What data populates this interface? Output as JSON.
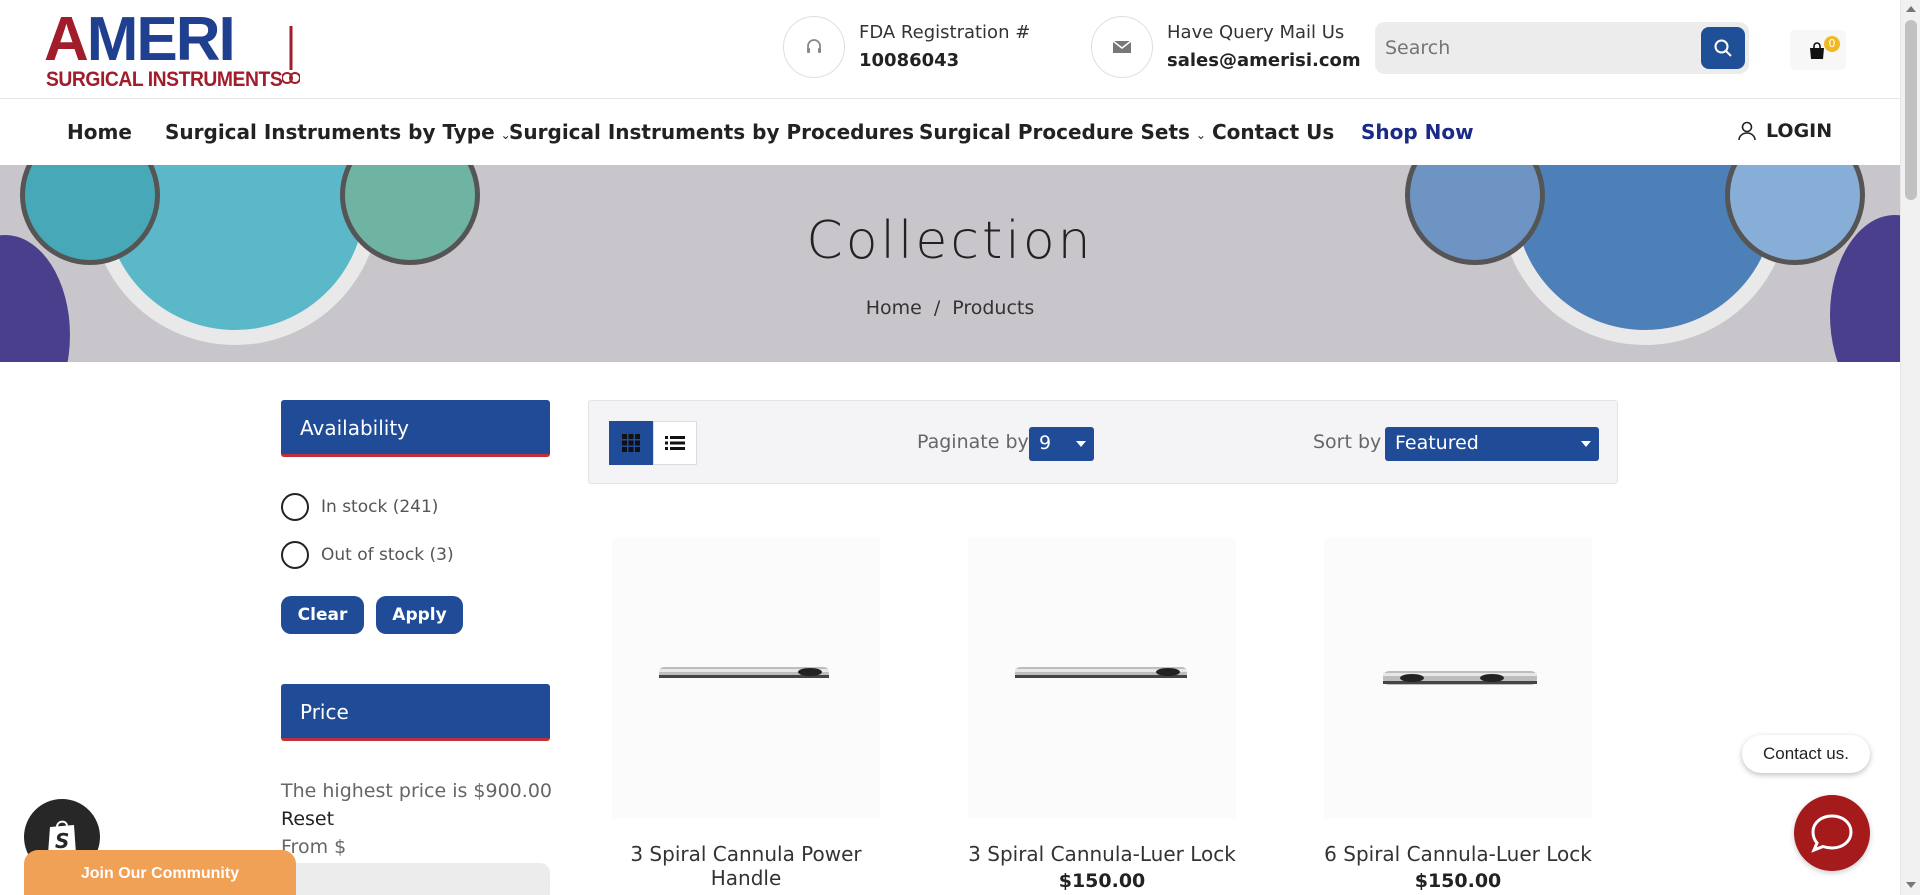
{
  "header": {
    "logo_text_part1": "A",
    "logo_text_part2": "MERI",
    "logo_subtitle": "SURGICAL INSTRUMENTS",
    "fda_label": "FDA Registration #",
    "fda_number": "10086043",
    "mail_label": "Have Query Mail Us",
    "mail_address": "sales@amerisi.com",
    "search_placeholder": "Search",
    "cart_count": "0"
  },
  "nav": {
    "items": [
      {
        "label": "Home"
      },
      {
        "label": "Surgical Instruments by Type"
      },
      {
        "label": "Surgical Instruments by Procedures"
      },
      {
        "label": "Surgical Procedure Sets"
      },
      {
        "label": "Contact Us"
      },
      {
        "label": "Shop Now"
      }
    ],
    "login_label": "LOGIN"
  },
  "hero": {
    "title": "Collection",
    "breadcrumb": [
      "Home",
      "Products"
    ]
  },
  "filters": {
    "availability": {
      "title": "Availability",
      "options": [
        {
          "label": "In stock (241)"
        },
        {
          "label": "Out of stock (3)"
        }
      ],
      "clear_label": "Clear",
      "apply_label": "Apply"
    },
    "price": {
      "title": "Price",
      "highest_text": "The highest price is $900.00",
      "reset_label": "Reset",
      "from_label": "From $"
    }
  },
  "toolbar": {
    "paginate_label": "Paginate by",
    "paginate_value": "9",
    "sort_label": "Sort by",
    "sort_value": "Featured"
  },
  "products": [
    {
      "name": "3 Spiral Cannula Power Handle",
      "price": ""
    },
    {
      "name": "3 Spiral Cannula-Luer Lock",
      "price": "$150.00"
    },
    {
      "name": "6 Spiral Cannula-Luer Lock",
      "price": "$150.00"
    }
  ],
  "widgets": {
    "contact_label": "Contact us.",
    "community_label": "Join Our Community"
  },
  "colors": {
    "brand_blue": "#1f4b97",
    "brand_red": "#a11d2b",
    "shop_now": "#1a2a86",
    "community": "#f0a156",
    "chat": "#a51b1b"
  }
}
